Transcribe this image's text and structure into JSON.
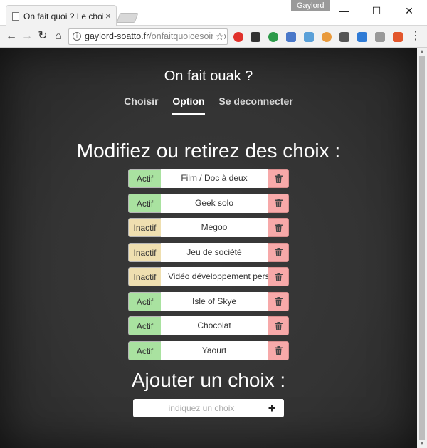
{
  "browser": {
    "tab_title": "On fait quoi ? Le choix al",
    "tab_close": "×",
    "profile_name": "Gaylord",
    "window_controls": {
      "minimize": "—",
      "maximize": "☐",
      "close": "✕"
    },
    "url_host": "gaylord-soatto.fr",
    "url_path": "/onfaitquoicesoir/op"
  },
  "site": {
    "title": "On fait ouak ?",
    "nav": [
      {
        "label": "Choisir",
        "active": false
      },
      {
        "label": "Option",
        "active": true
      },
      {
        "label": "Se deconnecter",
        "active": false
      }
    ]
  },
  "modify": {
    "heading": "Modifiez ou retirez des choix :",
    "items": [
      {
        "status": "Actif",
        "label": "Film / Doc à deux"
      },
      {
        "status": "Actif",
        "label": "Geek solo"
      },
      {
        "status": "Inactif",
        "label": "Megoo"
      },
      {
        "status": "Inactif",
        "label": "Jeu de société"
      },
      {
        "status": "Inactif",
        "label": "Vidéo développement perso"
      },
      {
        "status": "Actif",
        "label": "Isle of Skye"
      },
      {
        "status": "Actif",
        "label": "Chocolat"
      },
      {
        "status": "Actif",
        "label": "Yaourt"
      }
    ],
    "delete_icon": "trash-icon"
  },
  "add": {
    "heading": "Ajouter un choix :",
    "placeholder": "indiquez un choix",
    "button": "+"
  },
  "colors": {
    "active": "#a9e2a0",
    "inactive": "#efdfb0",
    "delete": "#f7a9a9",
    "background": "#333333"
  }
}
